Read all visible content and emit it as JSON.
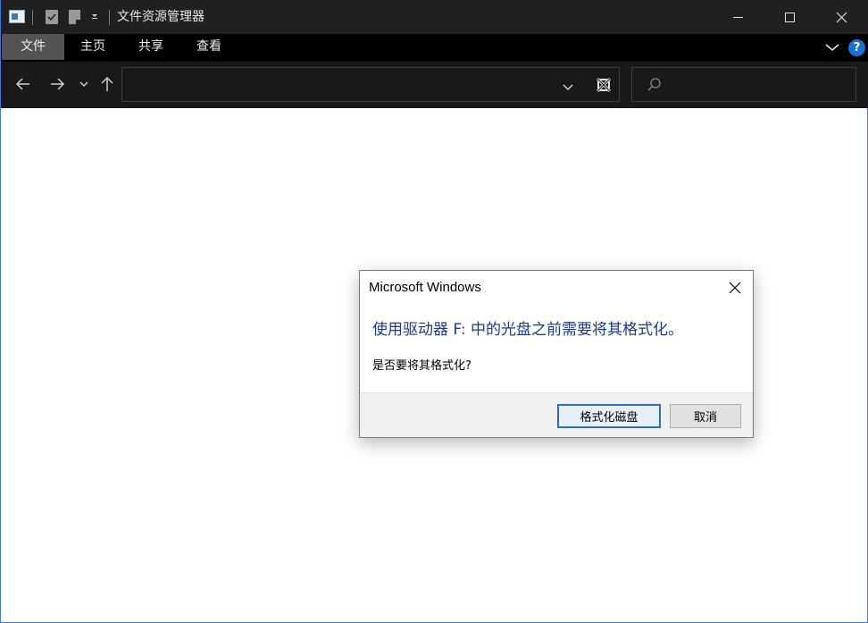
{
  "window": {
    "title": "文件资源管理器",
    "accent_color": "#3a7bd5"
  },
  "quick_access": {
    "icons": [
      "app-icon",
      "properties-icon",
      "new-folder-icon",
      "customize-dropdown-icon"
    ]
  },
  "ribbon": {
    "tabs": [
      {
        "label": "文件",
        "active": true
      },
      {
        "label": "主页",
        "active": false
      },
      {
        "label": "共享",
        "active": false
      },
      {
        "label": "查看",
        "active": false
      }
    ],
    "help_label": "?"
  },
  "navigation": {
    "address_value": "",
    "search_value": ""
  },
  "dialog": {
    "title": "Microsoft Windows",
    "main_instruction": "使用驱动器 F: 中的光盘之前需要将其格式化。",
    "content": "是否要将其格式化?",
    "buttons": {
      "format": "格式化磁盘",
      "cancel": "取消"
    },
    "main_color": "#1a3a8c"
  }
}
